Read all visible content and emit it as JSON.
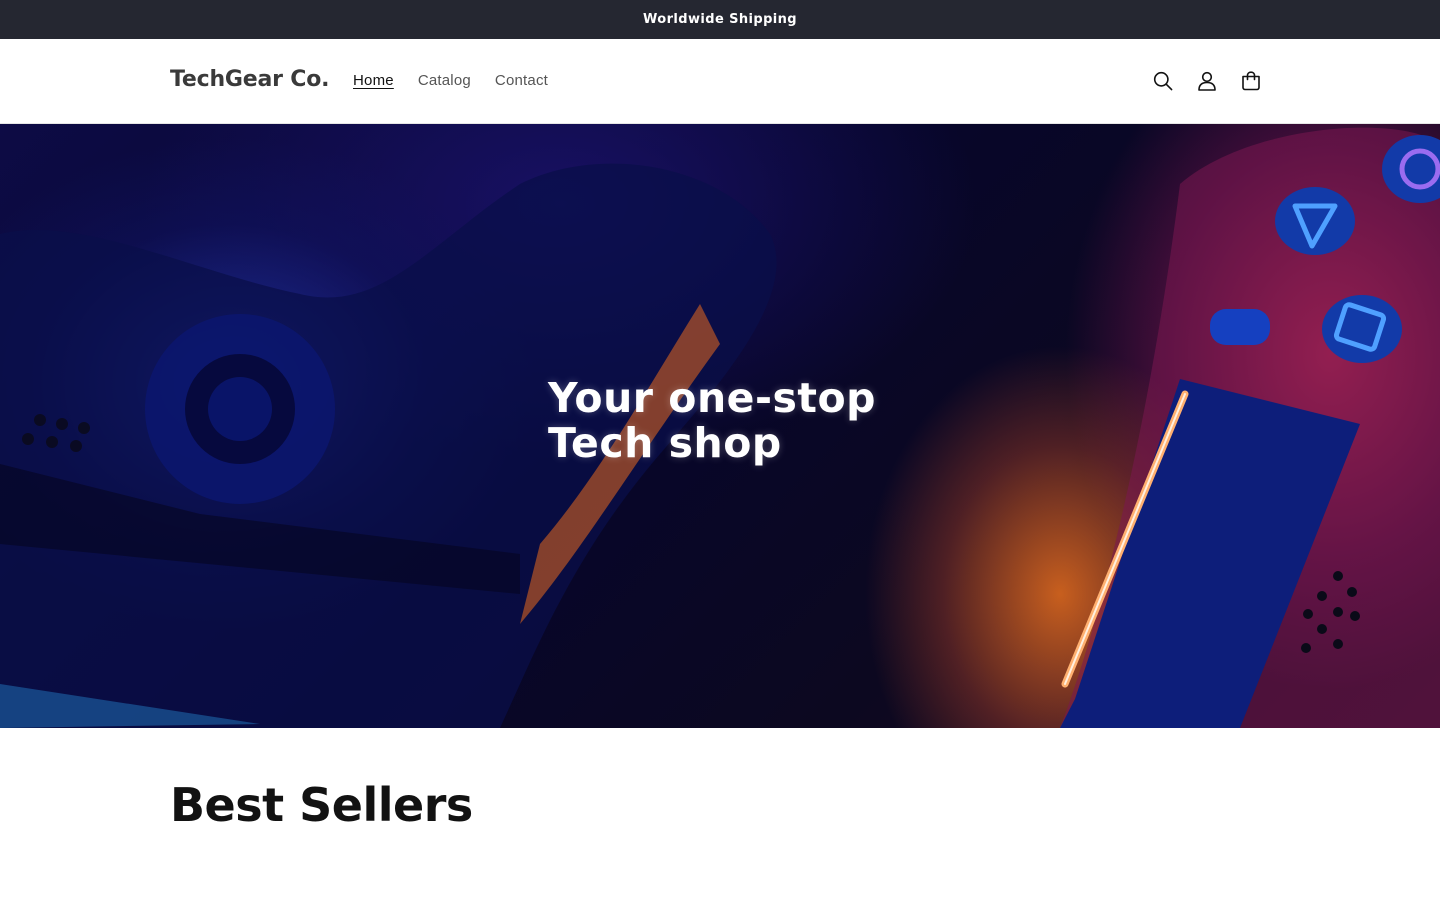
{
  "announcement": {
    "text": "Worldwide Shipping"
  },
  "header": {
    "logo": "TechGear Co.",
    "nav": [
      {
        "label": "Home",
        "active": true
      },
      {
        "label": "Catalog",
        "active": false
      },
      {
        "label": "Contact",
        "active": false
      }
    ],
    "icons": [
      "search-icon",
      "account-icon",
      "cart-icon"
    ]
  },
  "hero": {
    "title_line1": "Your one-stop",
    "title_line2": "Tech shop",
    "image": "gaming-controller-photo"
  },
  "featured": {
    "title": "Best Sellers"
  },
  "colors": {
    "announcement_bg": "#252731",
    "text": "#121212",
    "nav_text": "#555555"
  }
}
